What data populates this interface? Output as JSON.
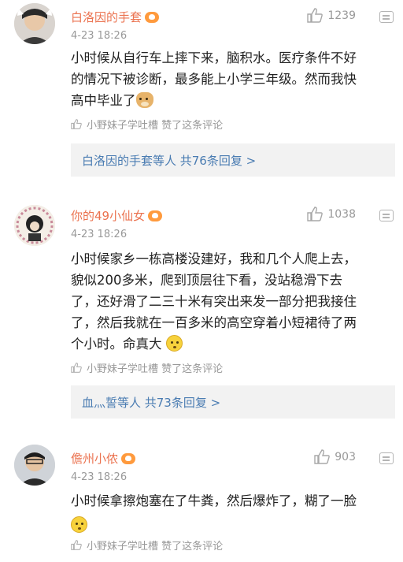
{
  "comments": [
    {
      "username": "白洛因的手套",
      "time": "4-23 18:26",
      "likes": "1239",
      "lines": [
        "小时候从自行车上摔下来，脑积水。医疗条件不好",
        "的情况下被诊断，最多能上小学三年级。然而我快",
        "高中毕业了"
      ],
      "liked_by": "小野妹子学吐槽 赞了这条评论",
      "replies": "白洛因的手套等人  共76条回复 >",
      "emoji": "doge-emoji"
    },
    {
      "username": "你的49小仙女",
      "time": "4-23 18:26",
      "likes": "1038",
      "lines": [
        "小时候家乡一栋高楼没建好，我和几个人爬上去，",
        "貌似200多米，爬到顶层往下看，没站稳滑下去",
        "了，还好滑了二三十米有突出来发一部分把我接住",
        "了，然后我就在一百多米的高空穿着小短裙待了两",
        "个小时。命真大"
      ],
      "liked_by": "小野妹子学吐槽 赞了这条评论",
      "replies": "血灬誓等人  共73条回复 >",
      "emoji": "face-emoji"
    },
    {
      "username": "儋州小侬",
      "time": "4-23 18:26",
      "likes": "903",
      "lines": [
        "小时候拿擦炮塞在了牛粪，然后爆炸了，糊了一脸"
      ],
      "liked_by": "小野妹子学吐槽 赞了这条评论",
      "emoji": "face-emoji"
    }
  ]
}
